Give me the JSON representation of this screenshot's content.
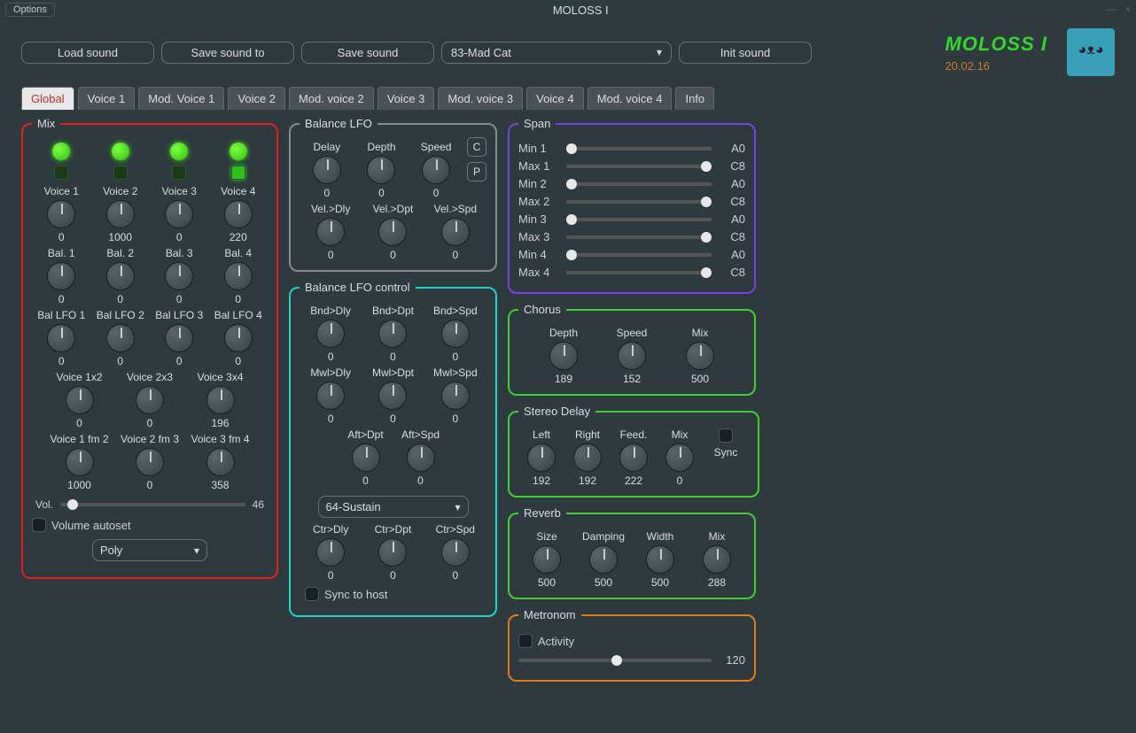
{
  "window": {
    "options": "Options",
    "title": "MOLOSS I",
    "minimize": "—",
    "close": "×"
  },
  "toolbar": {
    "load": "Load sound",
    "saveTo": "Save sound to",
    "save": "Save sound",
    "preset": "83-Mad Cat",
    "init": "Init sound"
  },
  "brand": {
    "title": "MOLOSS I",
    "version": "20.02.16"
  },
  "tabs": [
    "Global",
    "Voice 1",
    "Mod. Voice 1",
    "Voice 2",
    "Mod. voice 2",
    "Voice 3",
    "Mod. voice 3",
    "Voice 4",
    "Mod. voice 4",
    "Info"
  ],
  "mix": {
    "legend": "Mix",
    "voices": {
      "labels": [
        "Voice 1",
        "Voice 2",
        "Voice 3",
        "Voice 4"
      ],
      "values": [
        "0",
        "1000",
        "0",
        "220"
      ]
    },
    "bal": {
      "labels": [
        "Bal. 1",
        "Bal. 2",
        "Bal. 3",
        "Bal. 4"
      ],
      "values": [
        "0",
        "0",
        "0",
        "0"
      ]
    },
    "balLfo": {
      "labels": [
        "Bal LFO 1",
        "Bal LFO 2",
        "Bal LFO 3",
        "Bal LFO 4"
      ],
      "values": [
        "0",
        "0",
        "0",
        "0"
      ]
    },
    "vx": {
      "labels": [
        "Voice 1x2",
        "Voice 2x3",
        "Voice 3x4"
      ],
      "values": [
        "0",
        "0",
        "196"
      ]
    },
    "fm": {
      "labels": [
        "Voice 1 fm 2",
        "Voice 2 fm 3",
        "Voice 3 fm 4"
      ],
      "values": [
        "1000",
        "0",
        "358"
      ]
    },
    "vol": {
      "label": "Vol.",
      "value": "46"
    },
    "autoset": "Volume autoset",
    "mode": "Poly"
  },
  "balanceLfo": {
    "legend": "Balance LFO",
    "c": "C",
    "p": "P",
    "row1": {
      "labels": [
        "Delay",
        "Depth",
        "Speed"
      ],
      "values": [
        "0",
        "0",
        "0"
      ]
    },
    "row2": {
      "labels": [
        "Vel.>Dly",
        "Vel.>Dpt",
        "Vel.>Spd"
      ],
      "values": [
        "0",
        "0",
        "0"
      ]
    }
  },
  "balanceLfoCtl": {
    "legend": "Balance LFO control",
    "bnd": {
      "labels": [
        "Bnd>Dly",
        "Bnd>Dpt",
        "Bnd>Spd"
      ],
      "values": [
        "0",
        "0",
        "0"
      ]
    },
    "mwl": {
      "labels": [
        "Mwl>Dly",
        "Mwl>Dpt",
        "Mwl>Spd"
      ],
      "values": [
        "0",
        "0",
        "0"
      ]
    },
    "aft": {
      "labels": [
        "Aft>Dpt",
        "Aft>Spd"
      ],
      "values": [
        "0",
        "0"
      ]
    },
    "select": "64-Sustain",
    "ctr": {
      "labels": [
        "Ctr>Dly",
        "Ctr>Dpt",
        "Ctr>Spd"
      ],
      "values": [
        "0",
        "0",
        "0"
      ]
    },
    "sync": "Sync to host"
  },
  "span": {
    "legend": "Span",
    "rows": [
      {
        "label": "Min 1",
        "val": "A0",
        "pos": 0
      },
      {
        "label": "Max 1",
        "val": "C8",
        "pos": 100
      },
      {
        "label": "Min 2",
        "val": "A0",
        "pos": 0
      },
      {
        "label": "Max 2",
        "val": "C8",
        "pos": 100
      },
      {
        "label": "Min 3",
        "val": "A0",
        "pos": 0
      },
      {
        "label": "Max 3",
        "val": "C8",
        "pos": 100
      },
      {
        "label": "Min 4",
        "val": "A0",
        "pos": 0
      },
      {
        "label": "Max 4",
        "val": "C8",
        "pos": 100
      }
    ]
  },
  "chorus": {
    "legend": "Chorus",
    "labels": [
      "Depth",
      "Speed",
      "Mix"
    ],
    "values": [
      "189",
      "152",
      "500"
    ]
  },
  "delay": {
    "legend": "Stereo Delay",
    "labels": [
      "Left",
      "Right",
      "Feed.",
      "Mix"
    ],
    "values": [
      "192",
      "192",
      "222",
      "0"
    ],
    "sync": "Sync"
  },
  "reverb": {
    "legend": "Reverb",
    "labels": [
      "Size",
      "Damping",
      "Width",
      "Mix"
    ],
    "values": [
      "500",
      "500",
      "500",
      "288"
    ]
  },
  "metro": {
    "legend": "Metronom",
    "activity": "Activity",
    "value": "120"
  }
}
